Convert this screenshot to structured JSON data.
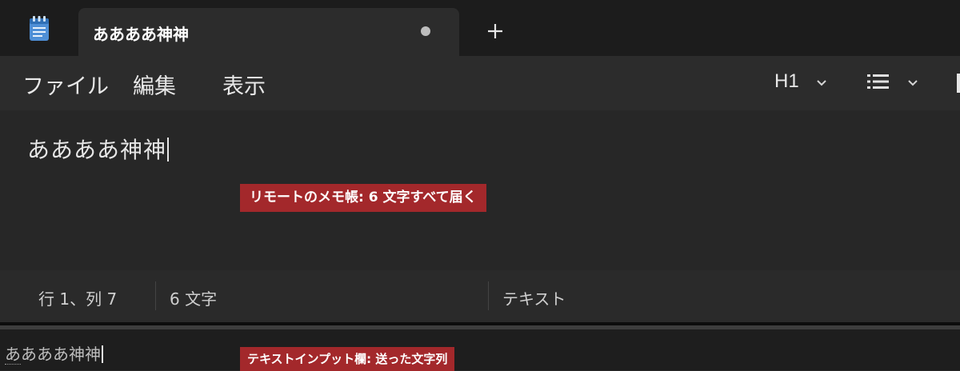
{
  "tab": {
    "title": "ああああ神神",
    "unsaved_indicator": "dot"
  },
  "menu": {
    "file": "ファイル",
    "edit": "編集",
    "view": "表示"
  },
  "toolbar": {
    "heading": "H1",
    "heading_icon": "chevron-down-icon",
    "list_icon": "bullet-list-icon"
  },
  "editor": {
    "content": "ああああ神神"
  },
  "annotations": {
    "editor_note": "リモートのメモ帳: 6 文字すべて届く",
    "input_note": "テキストインプット欄: 送った文字列"
  },
  "status": {
    "position": "行 1、列 7",
    "char_count": "6 文字",
    "format": "テキスト"
  },
  "input_field": {
    "first_char": "あ",
    "rest": "あああ神神"
  },
  "colors": {
    "annotation_bg": "#a3282b",
    "background": "#272727",
    "titlebar": "#1c1c1c"
  }
}
